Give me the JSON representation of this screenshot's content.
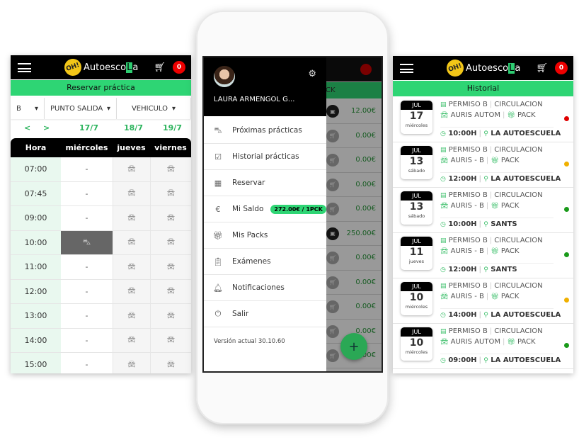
{
  "brand": {
    "logo_badge": "OH!",
    "logo_text": "Autoesco",
    "logo_highlight": "L",
    "logo_tail": "a",
    "cart_count": "0"
  },
  "reservar": {
    "title": "Reservar práctica",
    "filters": {
      "permiso": "B",
      "punto": "PUNTO SALIDA",
      "vehiculo": "VEHICULO"
    },
    "nav": {
      "prev": "<",
      "next": ">"
    },
    "dates": [
      "17/7",
      "18/7",
      "19/7"
    ],
    "columns": [
      "Hora",
      "miércoles",
      "jueves",
      "viernes"
    ],
    "rows": [
      {
        "hora": "07:00",
        "mie": "-"
      },
      {
        "hora": "07:45",
        "mie": "-"
      },
      {
        "hora": "09:00",
        "mie": "-"
      },
      {
        "hora": "10:00",
        "mie": "",
        "selected": true
      },
      {
        "hora": "11:00",
        "mie": "-"
      },
      {
        "hora": "12:00",
        "mie": "-"
      },
      {
        "hora": "13:00",
        "mie": "-"
      },
      {
        "hora": "14:00",
        "mie": "-"
      },
      {
        "hora": "15:00",
        "mie": "-"
      }
    ]
  },
  "menu": {
    "user": "LAURA ARMENGOL G...",
    "items": [
      {
        "label": "Próximas prácticas",
        "icon": "car-people-icon"
      },
      {
        "label": "Historial prácticas",
        "icon": "calendar-check-icon"
      },
      {
        "label": "Reservar",
        "icon": "calendar-icon"
      },
      {
        "label": "Mi Saldo",
        "icon": "money-bag-icon",
        "badge": "272.00€ / 1PCK"
      },
      {
        "label": "Mis Packs",
        "icon": "gift-icon"
      },
      {
        "label": "Exámenes",
        "icon": "clipboard-icon"
      },
      {
        "label": "Notificaciones",
        "icon": "bell-icon"
      },
      {
        "label": "Salir",
        "icon": "power-icon"
      }
    ],
    "version": "Versión actual 30.10.60",
    "background": {
      "tab": "CK",
      "amounts": [
        "12.00€",
        "0.00€",
        "0.00€",
        "0.00€",
        "0.00€",
        "250.00€",
        "0.00€",
        "0.00€",
        "0.00€",
        "0.00€",
        "0.00€"
      ]
    }
  },
  "historial": {
    "title": "Historial",
    "items": [
      {
        "month": "JUL",
        "day": "17",
        "weekday": "miércoles",
        "permiso": "PERMISO B",
        "tipo": "CIRCULACION",
        "vehiculo": "AURIS AUTOM",
        "pack": "PACK",
        "hora": "10:00H",
        "lugar": "LA AUTOESCUELA",
        "status": "#e00000"
      },
      {
        "month": "JUL",
        "day": "13",
        "weekday": "sábado",
        "permiso": "PERMISO B",
        "tipo": "CIRCULACION",
        "vehiculo": "AURIS - B",
        "pack": "PACK",
        "hora": "12:00H",
        "lugar": "LA AUTOESCUELA",
        "status": "#f0b000"
      },
      {
        "month": "JUL",
        "day": "13",
        "weekday": "sábado",
        "permiso": "PERMISO B",
        "tipo": "CIRCULACION",
        "vehiculo": "AURIS - B",
        "pack": "PACK",
        "hora": "10:00H",
        "lugar": "SANTS",
        "status": "#1a9a1a"
      },
      {
        "month": "JUL",
        "day": "11",
        "weekday": "jueves",
        "permiso": "PERMISO B",
        "tipo": "CIRCULACION",
        "vehiculo": "AURIS - B",
        "pack": "PACK",
        "hora": "12:00H",
        "lugar": "SANTS",
        "status": "#1a9a1a"
      },
      {
        "month": "JUL",
        "day": "10",
        "weekday": "miércoles",
        "permiso": "PERMISO B",
        "tipo": "CIRCULACION",
        "vehiculo": "AURIS - B",
        "pack": "PACK",
        "hora": "14:00H",
        "lugar": "LA AUTOESCUELA",
        "status": "#f0b000"
      },
      {
        "month": "JUL",
        "day": "10",
        "weekday": "miércoles",
        "permiso": "PERMISO B",
        "tipo": "CIRCULACION",
        "vehiculo": "AURIS AUTOM",
        "pack": "PACK",
        "hora": "09:00H",
        "lugar": "LA AUTOESCUELA",
        "status": "#1a9a1a"
      }
    ]
  }
}
